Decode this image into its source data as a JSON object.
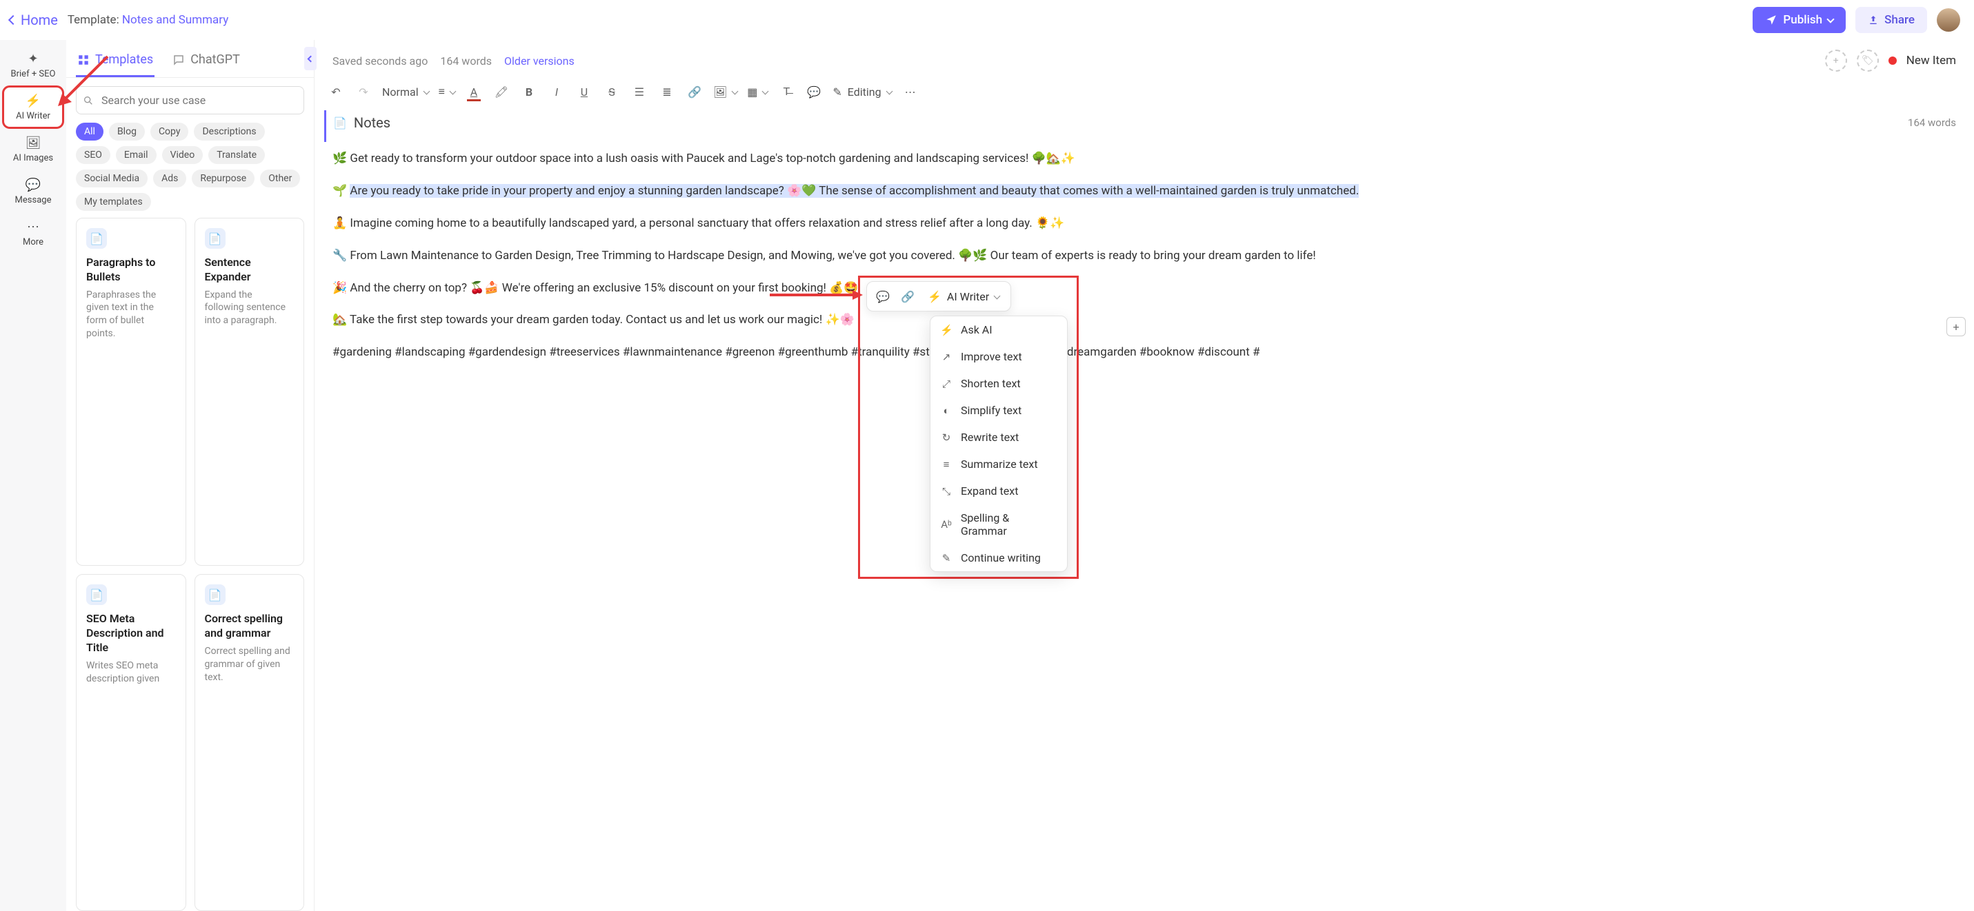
{
  "topbar": {
    "home": "Home",
    "template_prefix": "Template: ",
    "template_name": "Notes and Summary",
    "publish": "Publish",
    "share": "Share"
  },
  "leftrail": {
    "items": [
      {
        "label": "Brief + SEO",
        "icon": "✦"
      },
      {
        "label": "AI Writer",
        "icon": "⚡"
      },
      {
        "label": "AI Images",
        "icon": "🖼"
      },
      {
        "label": "Message",
        "icon": "💬"
      },
      {
        "label": "More",
        "icon": "⋯"
      }
    ]
  },
  "sidepanel": {
    "tabs": {
      "templates": "Templates",
      "chatgpt": "ChatGPT"
    },
    "search_placeholder": "Search your use case",
    "pills": [
      "All",
      "Blog",
      "Copy",
      "Descriptions",
      "SEO",
      "Email",
      "Video",
      "Translate",
      "Social Media",
      "Ads",
      "Repurpose",
      "Other",
      "My templates"
    ],
    "cards": [
      {
        "title": "Paragraphs to Bullets",
        "desc": "Paraphrases the given text in the form of bullet points."
      },
      {
        "title": "Sentence Expander",
        "desc": "Expand the following sentence into a paragraph."
      },
      {
        "title": "SEO Meta Description and Title",
        "desc": "Writes SEO meta description given"
      },
      {
        "title": "Correct spelling and grammar",
        "desc": "Correct spelling and grammar of given text."
      }
    ]
  },
  "editor": {
    "saved": "Saved seconds ago",
    "words_top": "164 words",
    "older": "Older versions",
    "new_item": "New Item",
    "style_select": "Normal",
    "mode": "Editing"
  },
  "doc": {
    "title": "Notes",
    "wc": "164 words",
    "p1": "🌿 Get ready to transform your outdoor space into a lush oasis with Paucek and Lage's top-notch gardening and landscaping services! 🌳🏡✨",
    "p2a": "🌱 ",
    "p2hl": "Are you ready to take pride in your property and enjoy a stunning garden landscape? 🌸💚 The sense of accomplishment and beauty that comes with a well-maintained garden is truly unmatched.",
    "p3": "🧘 Imagine coming home to a beautifully landscaped yard, a personal sanctuary that offers relaxation and stress relief after a long day. 🌻✨",
    "p4": "🔧 From Lawn Maintenance to Garden Design, Tree Trimming to Hardscape Design, and Mowing, we've got you covered. 🌳🌿 Our team of experts is ready to bring your dream garden to life!",
    "p5": "🎉 And the cherry on top? 🍒🍰 We're offering an exclusive 15% discount on your first booking! 💰🤩",
    "p6": "🏡 Take the first step towards your dream garden today. Contact us and let us work our magic! ✨🌸",
    "p7": "#gardening #landscaping #gardendesign #treeservices #lawnmaintenance #greenon #greenthumb #tranquility #stressrelief #outdooroasis #dreamgarden #booknow #discount #"
  },
  "ai_writer_btn": "AI Writer",
  "ai_menu": [
    {
      "icon": "⚡",
      "label": "Ask AI"
    },
    {
      "icon": "↗",
      "label": "Improve text"
    },
    {
      "icon": "⤢",
      "label": "Shorten text"
    },
    {
      "icon": "◐",
      "label": "Simplify text"
    },
    {
      "icon": "↻",
      "label": "Rewrite text"
    },
    {
      "icon": "≡",
      "label": "Summarize text"
    },
    {
      "icon": "⤡",
      "label": "Expand text"
    },
    {
      "icon": "Aᵇ",
      "label": "Spelling & Grammar"
    },
    {
      "icon": "✎",
      "label": "Continue writing"
    }
  ]
}
